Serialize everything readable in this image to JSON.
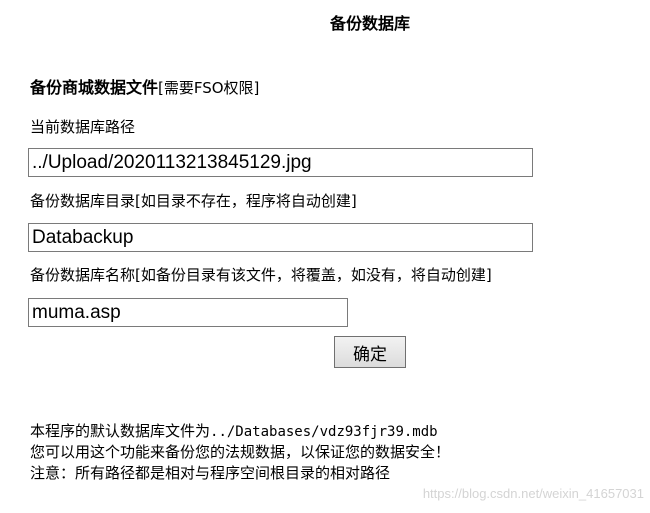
{
  "page": {
    "title": "备份数据库"
  },
  "section": {
    "title": "备份商城数据文件",
    "note": "[需要FSO权限]"
  },
  "form": {
    "db_path": {
      "label": "当前数据库路径",
      "value": "../Upload/2020113213845129.jpg"
    },
    "backup_dir": {
      "label": "备份数据库目录[如目录不存在，程序将自动创建]",
      "value": "Databackup"
    },
    "backup_name": {
      "label": "备份数据库名称[如备份目录有该文件，将覆盖，如没有，将自动创建]",
      "value": "muma.asp"
    },
    "submit_label": "确定"
  },
  "info": {
    "default_db_prefix": "本程序的默认数据库文件为",
    "default_db_path": "../Databases/vdz93fjr39.mdb",
    "line2": "您可以用这个功能来备份您的法规数据，以保证您的数据安全！",
    "line3": "注意：所有路径都是相对与程序空间根目录的相对路径"
  },
  "watermark": "https://blog.csdn.net/weixin_41657031"
}
